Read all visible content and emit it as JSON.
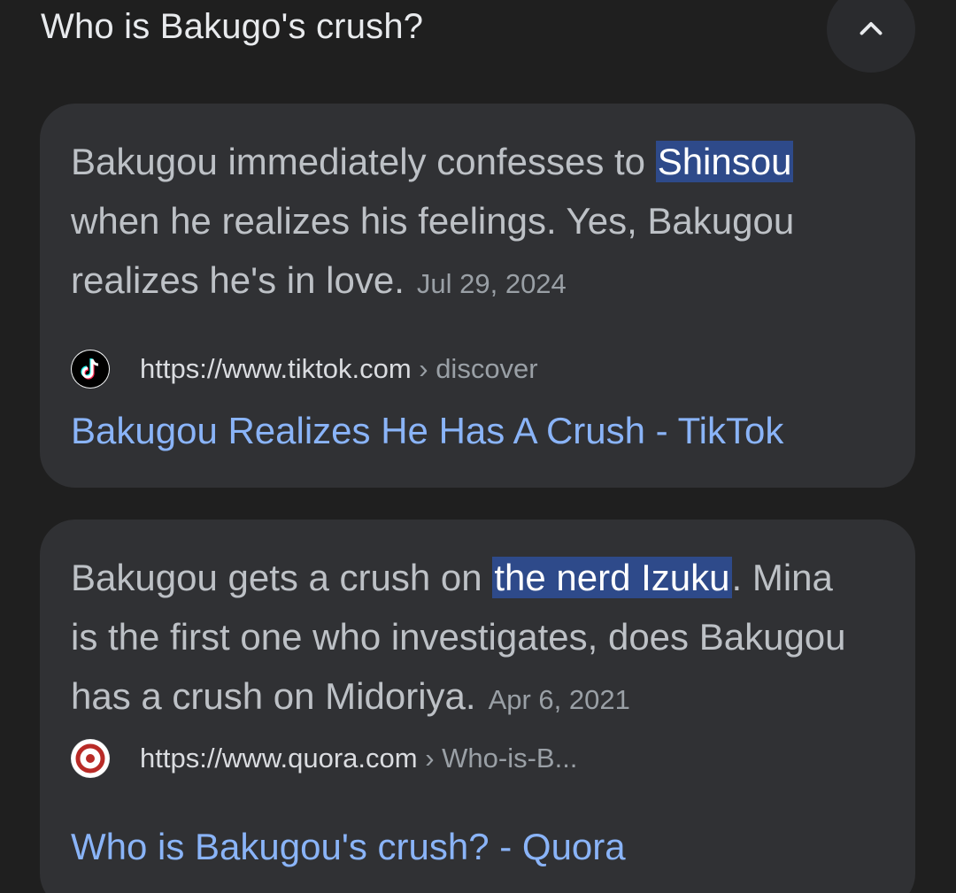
{
  "question": "Who is Bakugo's crush?",
  "results": [
    {
      "snippet_before": "Bakugou immediately confesses to ",
      "snippet_highlight": "Shinsou",
      "snippet_after": " when he realizes his feelings. Yes, Bakugou realizes he's in love.",
      "date": "Jul 29, 2024",
      "url_domain": "https://www.tiktok.com",
      "url_crumb": " › discover",
      "favicon": "tiktok-icon",
      "title": "Bakugou Realizes He Has A Crush - TikTok"
    },
    {
      "snippet_before": "Bakugou gets a crush on ",
      "snippet_highlight": "the nerd Izuku",
      "snippet_after": ". Mina is the first one who investigates, does Bakugou has a crush on Midoriya.",
      "date": "Apr 6, 2021",
      "url_domain": "https://www.quora.com",
      "url_crumb": " › Who-is-B...",
      "favicon": "quora-icon",
      "title": "Who is Bakugou's crush? - Quora"
    }
  ],
  "colors": {
    "background": "#1f1f1f",
    "card": "#303134",
    "highlight": "#2e4a8a",
    "link": "#8ab4f8"
  }
}
